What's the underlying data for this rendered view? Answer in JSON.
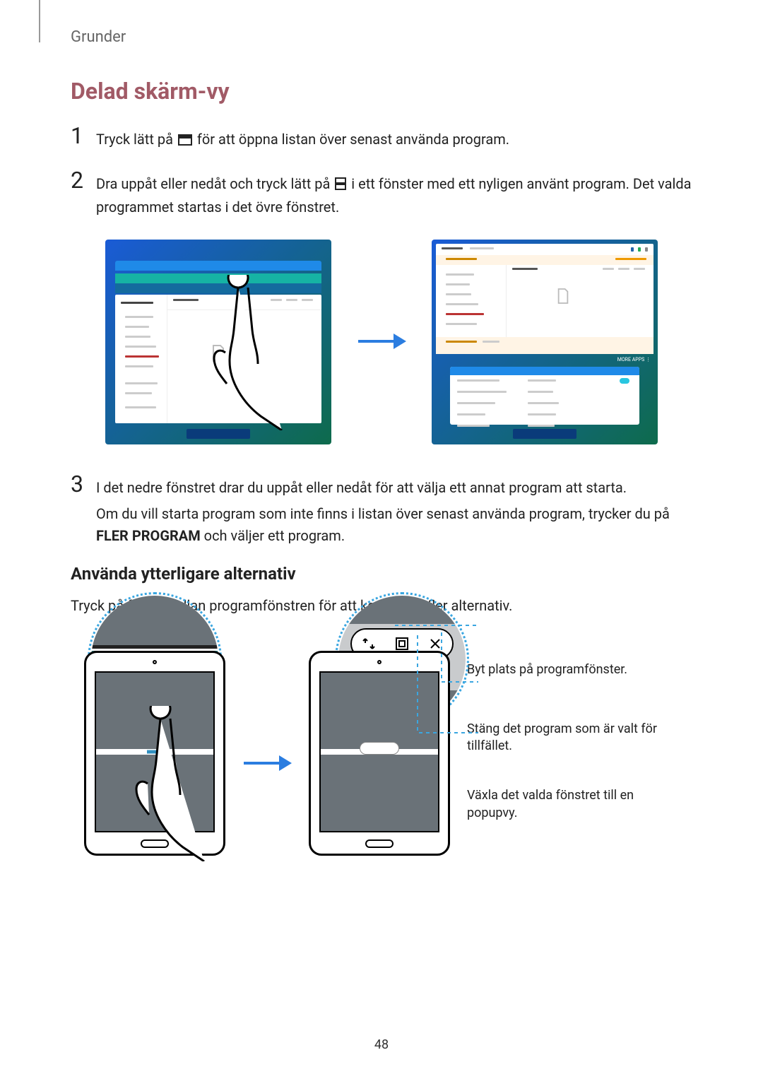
{
  "breadcrumb": "Grunder",
  "section_title": "Delad skärm-vy",
  "steps": [
    {
      "num": "1",
      "parts": [
        "Tryck lätt på ",
        " för att öppna listan över senast använda program."
      ]
    },
    {
      "num": "2",
      "parts": [
        "Dra uppåt eller nedåt och tryck lätt på ",
        " i ett fönster med ett nyligen använt program. Det valda programmet startas i det övre fönstret."
      ]
    },
    {
      "num": "3",
      "parts": [
        "I det nedre fönstret drar du uppåt eller nedåt för att välja ett annat program att starta."
      ],
      "extra_prefix": "Om du vill starta program som inte finns i listan över senast använda program, trycker du på ",
      "extra_bold": "FLER PROGRAM",
      "extra_suffix": " och väljer ett program."
    }
  ],
  "subheading": "Använda ytterligare alternativ",
  "sub_body": "Tryck på fältet mellan programfönstren för att komma åt fler alternativ.",
  "callouts": {
    "swap": "Byt plats på programfönster.",
    "close": "Stäng det program som är valt för tillfället.",
    "popup": "Växla det valda fönstret till en popupvy."
  },
  "page_number": "48"
}
